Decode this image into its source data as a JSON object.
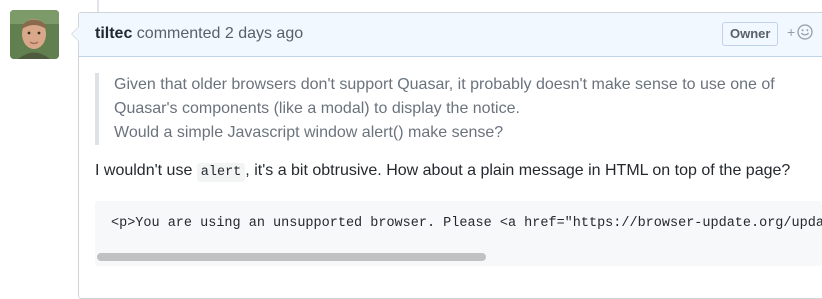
{
  "comment": {
    "author": "tiltec",
    "action": "commented",
    "time": "2 days ago",
    "badge": "Owner",
    "reaction_plus": "+",
    "reaction_icon": "smiley-icon",
    "quote_lines": [
      "Given that older browsers don't support Quasar, it probably doesn't make sense to use one of",
      "Quasar's components (like a modal) to display the notice.",
      "Would a simple Javascript window alert() make sense?"
    ],
    "reply_before": "I wouldn't use ",
    "reply_code": "alert",
    "reply_after": ", it's a bit obtrusive. How about a plain message in HTML on top of the page?",
    "code_line": "<p>You are using an unsupported browser. Please <a href=\"https://browser-update.org/update."
  },
  "colors": {
    "header_bg": "#f1f8ff",
    "header_border": "#c0d3eb",
    "quote_text": "#6a737d",
    "code_bg": "#f6f8fa"
  }
}
